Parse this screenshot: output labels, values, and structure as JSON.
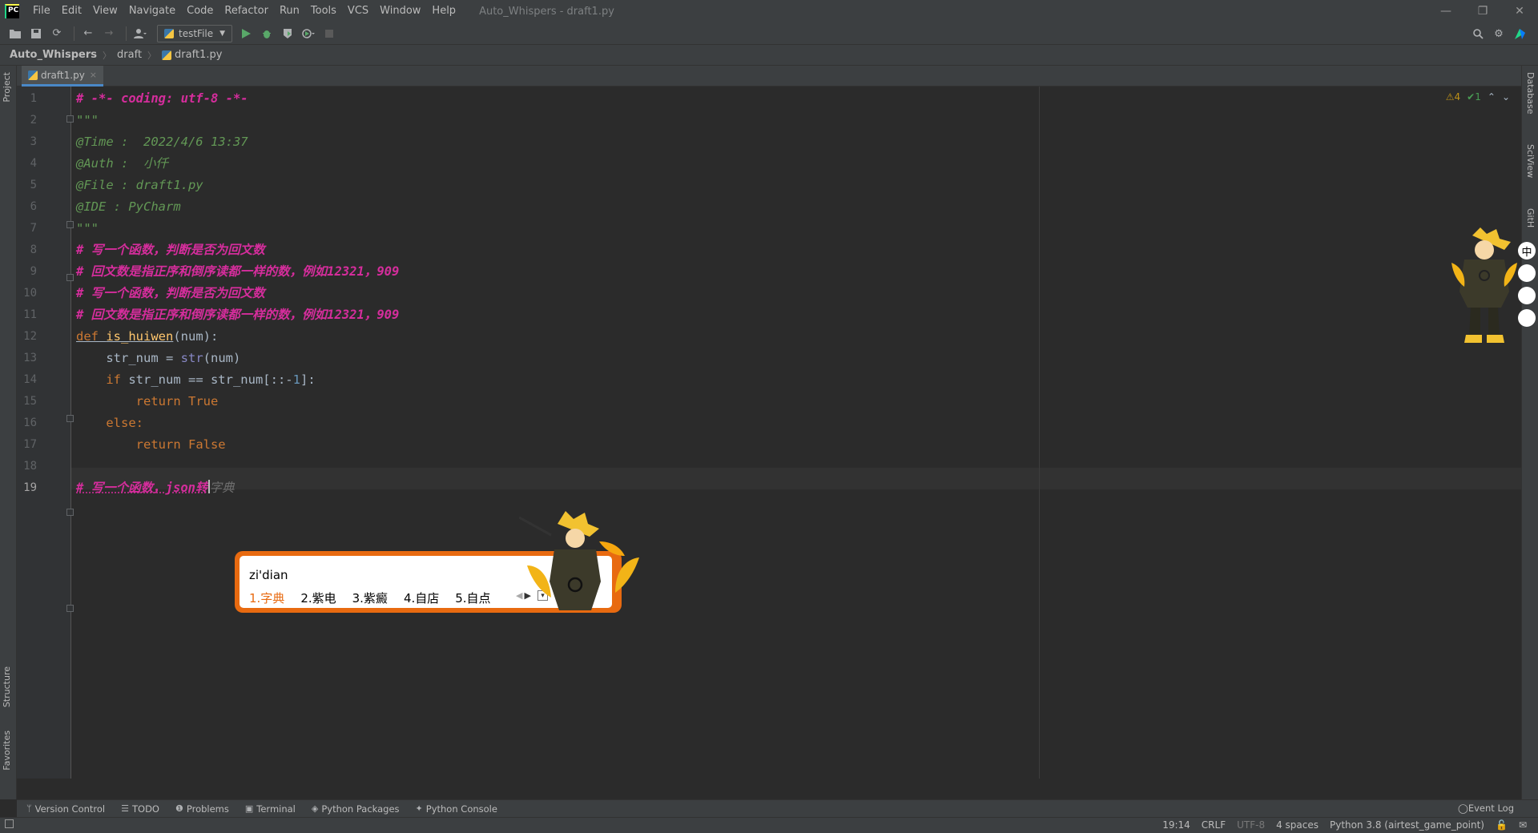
{
  "menu": {
    "logo": "PC",
    "items": [
      "File",
      "Edit",
      "View",
      "Navigate",
      "Code",
      "Refactor",
      "Run",
      "Tools",
      "VCS",
      "Window",
      "Help"
    ],
    "window_title": "Auto_Whispers - draft1.py"
  },
  "window_controls": {
    "minimize": "—",
    "restore": "❐",
    "close": "✕"
  },
  "toolbar": {
    "run_config": "testFile"
  },
  "breadcrumb": {
    "project": "Auto_Whispers",
    "folder": "draft",
    "file": "draft1.py"
  },
  "left_tabs": {
    "project": "Project",
    "structure": "Structure",
    "favorites": "Favorites"
  },
  "right_tabs": {
    "database": "Database",
    "sciview": "SciView",
    "github": "GitH"
  },
  "editor_tab": {
    "label": "draft1.py",
    "close": "×"
  },
  "inspections": {
    "warnings": "⚠4",
    "ok": "✔1",
    "up": "⌃",
    "down": "⌄"
  },
  "code": {
    "l1": "# -*- coding: utf-8 -*-",
    "l2": "\"\"\"",
    "l3": "@Time :  2022/4/6 13:37",
    "l4": "@Auth :  小仟",
    "l5": "@File : draft1.py",
    "l6": "@IDE : PyCharm",
    "l7": "\"\"\"",
    "l8": "# 写一个函数，判断是否为回文数",
    "l9": "# 回文数是指正序和倒序读都一样的数，例如12321，909",
    "l10": "# 写一个函数，判断是否为回文数",
    "l11": "# 回文数是指正序和倒序读都一样的数，例如12321，909",
    "l12_def": "def ",
    "l12_name": "is_huiwen",
    "l12_rest": "(num):",
    "l13_a": "    str_num = ",
    "l13_b": "str",
    "l13_c": "(num)",
    "l14_a": "    if ",
    "l14_b": "str_num == str_num[::-",
    "l14_c": "1",
    "l14_d": "]:",
    "l15_a": "        return ",
    "l15_b": "True",
    "l16": "    else:",
    "l17_a": "        return ",
    "l17_b": "False",
    "l19_typed": "# 写一个函数，json转",
    "l19_ghost": "字典"
  },
  "line_numbers": [
    "1",
    "2",
    "3",
    "4",
    "5",
    "6",
    "7",
    "8",
    "9",
    "10",
    "11",
    "12",
    "13",
    "14",
    "15",
    "16",
    "17",
    "18",
    "19"
  ],
  "ime": {
    "input": "zi'dian",
    "candidates": [
      "1.字典",
      "2.紫电",
      "3.紫癜",
      "4.自店",
      "5.自点"
    ],
    "prev": "◀",
    "next": "▶",
    "more": "▾"
  },
  "bottom_tools": [
    "Version Control",
    "TODO",
    "Problems",
    "Terminal",
    "Python Packages",
    "Python Console"
  ],
  "event_log": "Event Log",
  "status": {
    "position": "19:14",
    "line_sep": "CRLF",
    "encoding": "UTF-8",
    "indent": "4 spaces",
    "interpreter": "Python 3.8 (airtest_game_point)"
  },
  "colors": {
    "accent": "#4a88c7",
    "comment_pink": "#d52d9c",
    "keyword": "#cc7832",
    "ime_orange": "#e86a10"
  }
}
